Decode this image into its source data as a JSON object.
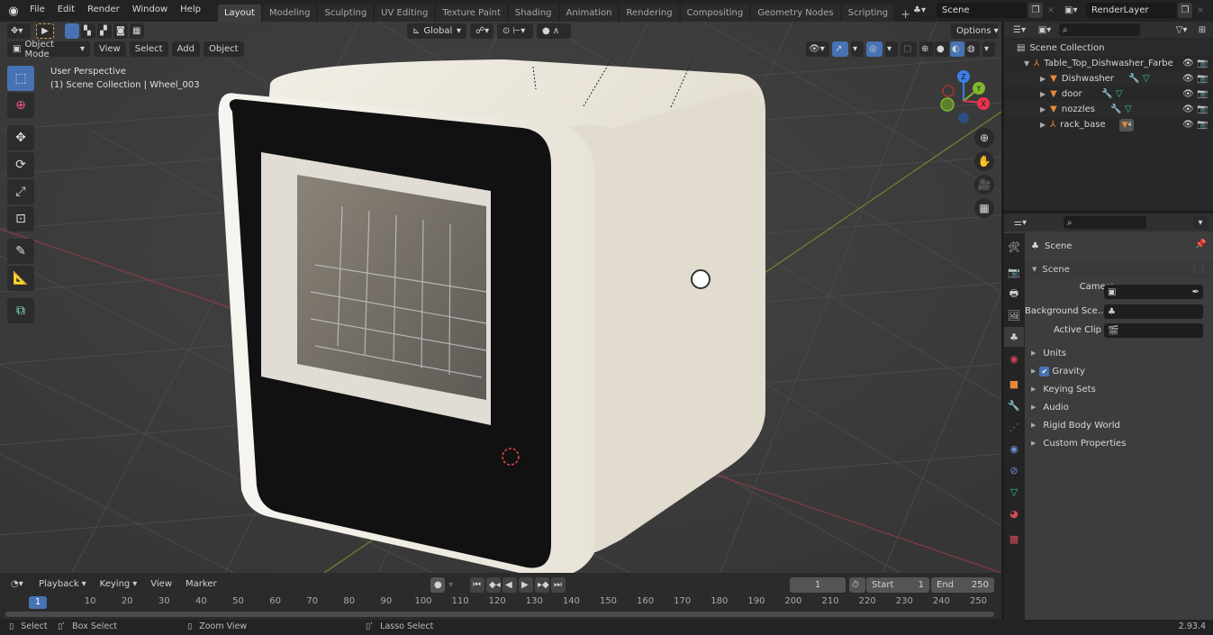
{
  "app": {
    "version": "2.93.4"
  },
  "menu": [
    "File",
    "Edit",
    "Render",
    "Window",
    "Help"
  ],
  "workspaces": {
    "tabs": [
      "Layout",
      "Modeling",
      "Sculpting",
      "UV Editing",
      "Texture Paint",
      "Shading",
      "Animation",
      "Rendering",
      "Compositing",
      "Geometry Nodes",
      "Scripting"
    ],
    "active": "Layout",
    "add_label": "+"
  },
  "scene_selector": {
    "value": "Scene",
    "icon": "scene-icon"
  },
  "view_layer_selector": {
    "value": "RenderLayer",
    "icon": "render-layer-icon"
  },
  "viewport_header": {
    "mode": "Object Mode",
    "menus": [
      "View",
      "Select",
      "Add",
      "Object"
    ],
    "transform_orientation": "Global",
    "options_label": "Options"
  },
  "viewport": {
    "perspective_label": "User Perspective",
    "context_label": "(1) Scene Collection | Wheel_003",
    "tools": [
      "select-box",
      "cursor",
      "move",
      "rotate",
      "scale",
      "transform",
      "annotate",
      "measure",
      "add-cube"
    ],
    "active_tool": "select-box",
    "gizmo_axes": [
      "X",
      "Y",
      "Z"
    ],
    "nav_buttons": [
      "zoom",
      "pan",
      "camera",
      "ortho-toggle"
    ],
    "object": "Table Top Dishwasher"
  },
  "outliner": {
    "search_placeholder": "",
    "root": "Scene Collection",
    "items": [
      {
        "name": "Table_Top_Dishwasher_Farbe",
        "type": "empty",
        "level": 1,
        "expanded": true
      },
      {
        "name": "Dishwasher",
        "type": "mesh",
        "level": 2,
        "modifiers": [
          "modifier",
          "mesh-data"
        ]
      },
      {
        "name": "door",
        "type": "mesh",
        "level": 2,
        "modifiers": [
          "modifier",
          "mesh-data"
        ]
      },
      {
        "name": "nozzles",
        "type": "mesh",
        "level": 2,
        "modifiers": [
          "modifier",
          "mesh-data"
        ]
      },
      {
        "name": "rack_base",
        "type": "empty",
        "level": 2,
        "children_badge": "4"
      }
    ]
  },
  "properties": {
    "search_placeholder": "",
    "context_title": "Scene",
    "panel_title": "Scene",
    "fields": [
      {
        "label": "Camera",
        "value": "",
        "icon": "camera-object-icon"
      },
      {
        "label": "Background Sce...",
        "value": "",
        "icon": "scene-icon"
      },
      {
        "label": "Active Clip",
        "value": "",
        "icon": "clip-icon"
      }
    ],
    "subpanels": [
      {
        "label": "Units"
      },
      {
        "label": "Gravity",
        "checkbox": true
      },
      {
        "label": "Keying Sets"
      },
      {
        "label": "Audio"
      },
      {
        "label": "Rigid Body World"
      },
      {
        "label": "Custom Properties"
      }
    ],
    "tabs": [
      "tool",
      "render",
      "output",
      "view-layer",
      "scene",
      "world",
      "object",
      "modifiers",
      "particles",
      "physics",
      "constraints",
      "data",
      "material",
      "texture"
    ],
    "active_tab": "scene"
  },
  "timeline": {
    "menus": [
      "Playback",
      "Keying",
      "View",
      "Marker"
    ],
    "current_frame": "1",
    "start_label": "Start",
    "start": "1",
    "end_label": "End",
    "end": "250",
    "ruler": [
      "1",
      "10",
      "20",
      "30",
      "40",
      "50",
      "60",
      "70",
      "80",
      "90",
      "100",
      "110",
      "120",
      "130",
      "140",
      "150",
      "160",
      "170",
      "180",
      "190",
      "200",
      "210",
      "220",
      "230",
      "240",
      "250"
    ]
  },
  "statusbar": {
    "hints": [
      {
        "icon": "mouse-left-icon",
        "label": "Select"
      },
      {
        "icon": "mouse-drag-icon",
        "label": "Box Select"
      },
      {
        "icon": "mouse-middle-icon",
        "label": "Zoom View"
      },
      {
        "icon": "mouse-right-icon",
        "label": "Lasso Select"
      }
    ]
  },
  "colors": {
    "accent": "#4772b3",
    "x_axis": "#e8344f",
    "y_axis": "#7fb82e",
    "z_axis": "#3d80e6",
    "object_orange": "#e6883a",
    "mesh_green": "#2dc78a"
  }
}
